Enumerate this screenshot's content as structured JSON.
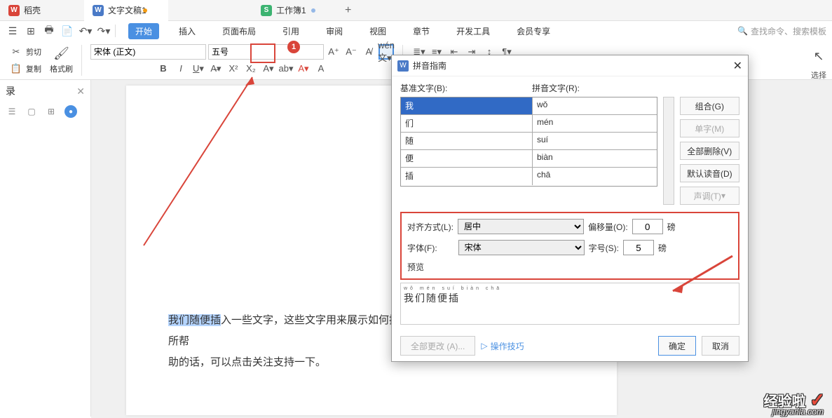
{
  "tabs": [
    {
      "icon": "W",
      "label": "稻壳"
    },
    {
      "icon": "W",
      "label": "文字文稿1"
    },
    {
      "icon": "S",
      "label": "工作簿1"
    }
  ],
  "menu": {
    "items": [
      "开始",
      "插入",
      "页面布局",
      "引用",
      "审阅",
      "视图",
      "章节",
      "开发工具",
      "会员专享"
    ],
    "active": 0
  },
  "search": {
    "placeholder": "查找命令、搜索模板"
  },
  "toolbar": {
    "clipboard": {
      "cut": "剪切",
      "copy": "复制",
      "brush": "格式刷"
    },
    "font": {
      "name": "宋体 (正文)",
      "size": "五号"
    }
  },
  "left_panel": {
    "title": "录"
  },
  "right": {
    "select": "选择"
  },
  "dialog": {
    "title": "拼音指南",
    "base_label": "基准文字(B):",
    "pinyin_label": "拼音文字(R):",
    "rows": [
      {
        "base": "我",
        "pinyin": "wǒ"
      },
      {
        "base": "们",
        "pinyin": "mén"
      },
      {
        "base": "随",
        "pinyin": "suí"
      },
      {
        "base": "便",
        "pinyin": "biàn"
      },
      {
        "base": "插",
        "pinyin": "chā"
      }
    ],
    "buttons": {
      "combine": "组合(G)",
      "single": "单字(M)",
      "delete_all": "全部删除(V)",
      "default": "默认读音(D)",
      "tone": "声调(T)"
    },
    "align_label": "对齐方式(L):",
    "align_value": "居中",
    "offset_label": "偏移量(O):",
    "offset_value": "0",
    "unit1": "磅",
    "font_label": "字体(F):",
    "font_value": "宋体",
    "size_label": "字号(S):",
    "size_value": "5",
    "unit2": "磅",
    "preview_label": "预览",
    "preview_ruby": "wǒ mén suí biàn chā",
    "preview_text": "我们随便插",
    "footer": {
      "change_all": "全部更改 (A)...",
      "tips": "操作技巧",
      "ok": "确定",
      "cancel": "取消"
    }
  },
  "doc": {
    "selected": "我们随便插",
    "rest1": "入一些文字，这些文字用来展示如何把拼音打在汉字后面，如果本文对你有所帮",
    "rest2": "助的话，可以点击关注支持一下。"
  },
  "watermark": {
    "main": "经验啦",
    "sub": "jingyanla.com"
  }
}
